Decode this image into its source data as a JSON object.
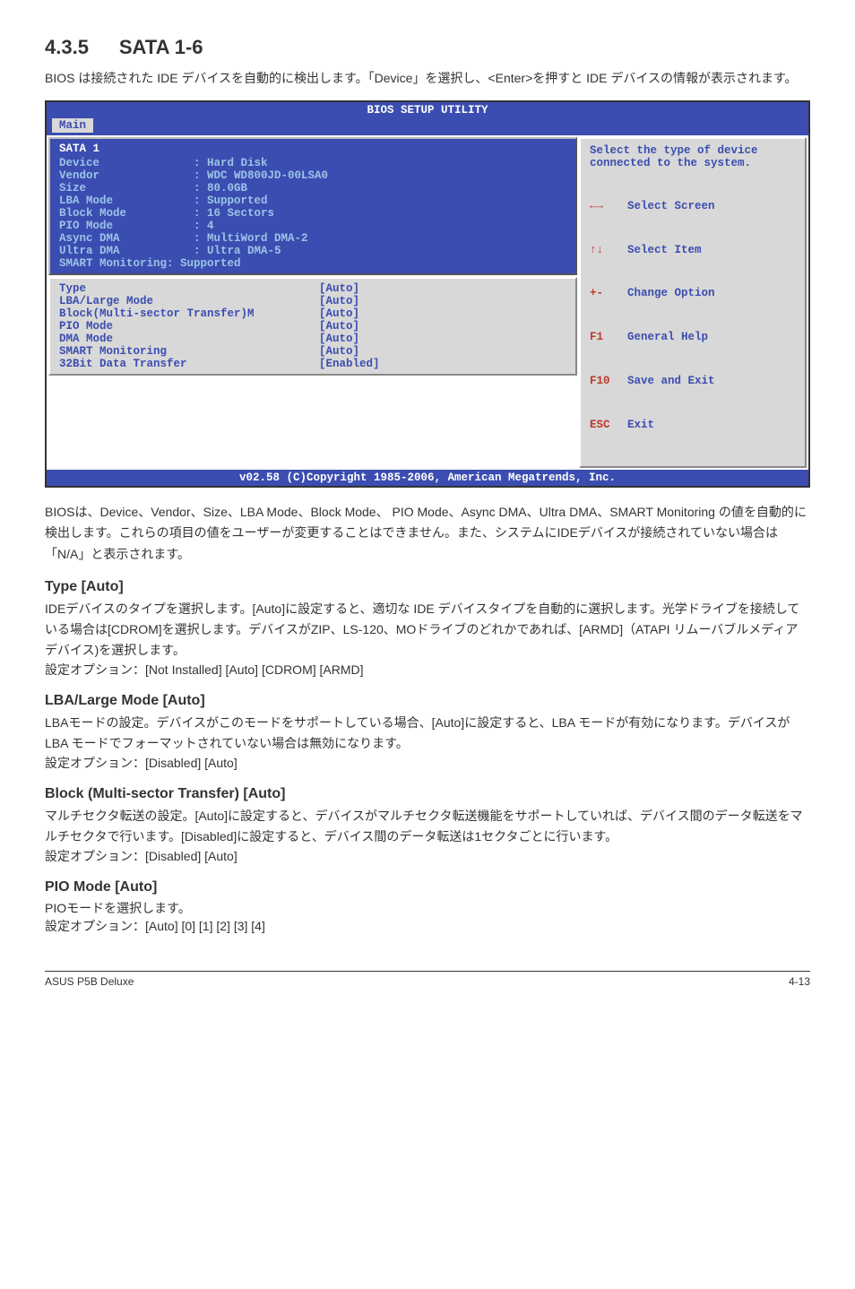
{
  "section": {
    "number": "4.3.5",
    "title": "SATA 1-6"
  },
  "intro": "BIOS は接続された IDE デバイスを自動的に検出します。「Device」を選択し、<Enter>を押すと IDE デバイスの情報が表示されます。",
  "bios": {
    "title": "BIOS SETUP UTILITY",
    "tab": "Main",
    "panelHeading": "SATA 1",
    "infoRows": [
      {
        "label": "Device",
        "value": ": Hard Disk"
      },
      {
        "label": "Vendor",
        "value": ": WDC WD800JD-00LSA0"
      },
      {
        "label": "Size",
        "value": ": 80.0GB"
      },
      {
        "label": "LBA Mode",
        "value": ": Supported"
      },
      {
        "label": "Block Mode",
        "value": ": 16 Sectors"
      },
      {
        "label": "PIO Mode",
        "value": ": 4"
      },
      {
        "label": "Async DMA",
        "value": ": MultiWord DMA-2"
      },
      {
        "label": "Ultra DMA",
        "value": ": Ultra DMA-5"
      },
      {
        "label": "SMART Monitoring",
        "value": ": Supported"
      }
    ],
    "settingRows": [
      {
        "label": "Type",
        "value": "[Auto]"
      },
      {
        "label": "LBA/Large Mode",
        "value": "[Auto]"
      },
      {
        "label": "Block(Multi-sector Transfer)M",
        "value": "[Auto]"
      },
      {
        "label": "PIO Mode",
        "value": "[Auto]"
      },
      {
        "label": "DMA Mode",
        "value": "[Auto]"
      },
      {
        "label": "SMART Monitoring",
        "value": "[Auto]"
      },
      {
        "label": "32Bit Data Transfer",
        "value": "[Enabled]"
      }
    ],
    "helpTop": "Select the type of device connected to the system.",
    "nav": [
      {
        "key": "←→",
        "text": "Select Screen"
      },
      {
        "key": "↑↓",
        "text": "Select Item"
      },
      {
        "key": "+-",
        "text": "Change Option"
      },
      {
        "key": "F1",
        "text": "General Help"
      },
      {
        "key": "F10",
        "text": "Save and Exit"
      },
      {
        "key": "ESC",
        "text": "Exit"
      }
    ],
    "footer": "v02.58 (C)Copyright 1985-2006, American Megatrends, Inc."
  },
  "afterBios": "BIOSは、Device、Vendor、Size、LBA Mode、Block Mode、 PIO Mode、Async DMA、Ultra DMA、SMART Monitoring の値を自動的に検出します。これらの項目の値をユーザーが変更することはできません。また、システムにIDEデバイスが接続されていない場合は「N/A」と表示されます。",
  "type": {
    "heading": "Type [Auto]",
    "body": "IDEデバイスのタイプを選択します。[Auto]に設定すると、適切な IDE デバイスタイプを自動的に選択します。光学ドライブを接続している場合は[CDROM]を選択します。デバイスがZIP、LS-120、MOドライブのどれかであれば、[ARMD]（ATAPI リムーバブルメディアデバイス)を選択します。",
    "opts": "設定オプション：[Not Installed] [Auto] [CDROM] [ARMD]"
  },
  "lba": {
    "heading": "LBA/Large Mode [Auto]",
    "body": "LBAモードの設定。デバイスがこのモードをサポートしている場合、[Auto]に設定すると、LBA モードが有効になります。デバイスが LBA モードでフォーマットされていない場合は無効になります。",
    "opts": "設定オプション：[Disabled] [Auto]"
  },
  "block": {
    "heading": "Block (Multi-sector Transfer) [Auto]",
    "body": "マルチセクタ転送の設定。[Auto]に設定すると、デバイスがマルチセクタ転送機能をサポートしていれば、デバイス間のデータ転送をマルチセクタで行います。[Disabled]に設定すると、デバイス間のデータ転送は1セクタごとに行います。",
    "opts": "設定オプション：[Disabled] [Auto]"
  },
  "pio": {
    "heading": "PIO Mode [Auto]",
    "body": "PIOモードを選択します。",
    "opts": "設定オプション：[Auto] [0] [1] [2] [3] [4]"
  },
  "footer": {
    "left": "ASUS P5B Deluxe",
    "right": "4-13"
  }
}
